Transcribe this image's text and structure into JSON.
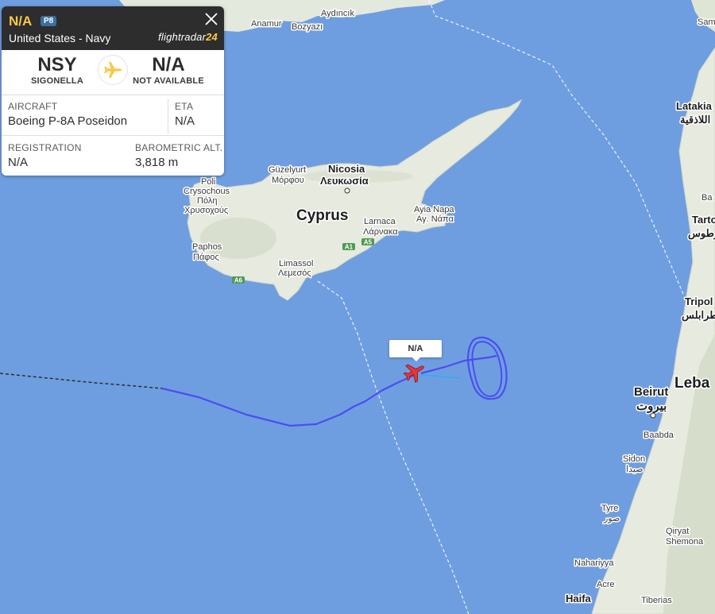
{
  "panel": {
    "callsign": "N/A",
    "type_badge": "P8",
    "operator": "United States - Navy",
    "brand_text": "flightradar",
    "brand_num": "24",
    "origin_code": "NSY",
    "origin_name": "SIGONELLA",
    "dest_code": "N/A",
    "dest_name": "NOT AVAILABLE",
    "aircraft_label": "AIRCRAFT",
    "aircraft_value": "Boeing P-8A Poseidon",
    "eta_label": "ETA",
    "eta_value": "N/A",
    "registration_label": "REGISTRATION",
    "registration_value": "N/A",
    "baro_label": "BAROMETRIC ALT.",
    "baro_value": "3,818 m"
  },
  "marker": {
    "label": "N/A"
  },
  "map_labels": {
    "cyprus": "Cyprus",
    "nicosia": "Nicosia",
    "nicosia_gr": "Λευκωσία",
    "guzelyurt": "Güzelyurt",
    "guzelyurt_gr": "Μόρφου",
    "larnaca": "Larnaca",
    "larnaca_gr": "Λάρνακα",
    "ayia_napa": "Ayia Napa",
    "ayia_napa_gr": "Αγ. Νάπα",
    "limassol": "Limassol",
    "limassol_gr": "Λεμεσός",
    "paphos": "Paphos",
    "paphos_gr": "Πάφος",
    "poli": "Poli",
    "crysochous": "Crysochous",
    "poli_gr": "Πόλη",
    "crysochous_gr": "Χρυσοχούς",
    "anamur": "Anamur",
    "bozyazi": "Bozyazı",
    "aydincik": "Aydıncık",
    "sam": "Sam",
    "latakia": "Latakia",
    "latakia_ar": "اللاذقية",
    "ba": "Ba",
    "tarto": "Tarto",
    "tartous_ar": "طرطوس",
    "tripoli": "Tripol",
    "tripoli_ar": "طرابلس",
    "beirut": "Beirut",
    "beirut_ar": "بيروت",
    "lebanon": "Leba",
    "baabda": "Baabda",
    "sidon": "Sidon",
    "sidon_ar": "صيدا",
    "tyre": "Tyre",
    "tyre_ar": "صور",
    "qiryat_shemona_1": "Qiryat",
    "qiryat_shemona_2": "Shemona",
    "nahariyya": "Nahariyya",
    "acre": "Acre",
    "haifa": "Haifa",
    "tiberias": "Tiberias",
    "road_a1": "A1",
    "road_a5": "A5",
    "road_a6": "A6"
  },
  "colors": {
    "sea": "#6f9ee0",
    "land": "#e9ece4",
    "track": "#4a4ef0",
    "track_estimated": "#38a9f0",
    "aircraft": "#e8343a",
    "accent_yellow": "#f7c948"
  }
}
